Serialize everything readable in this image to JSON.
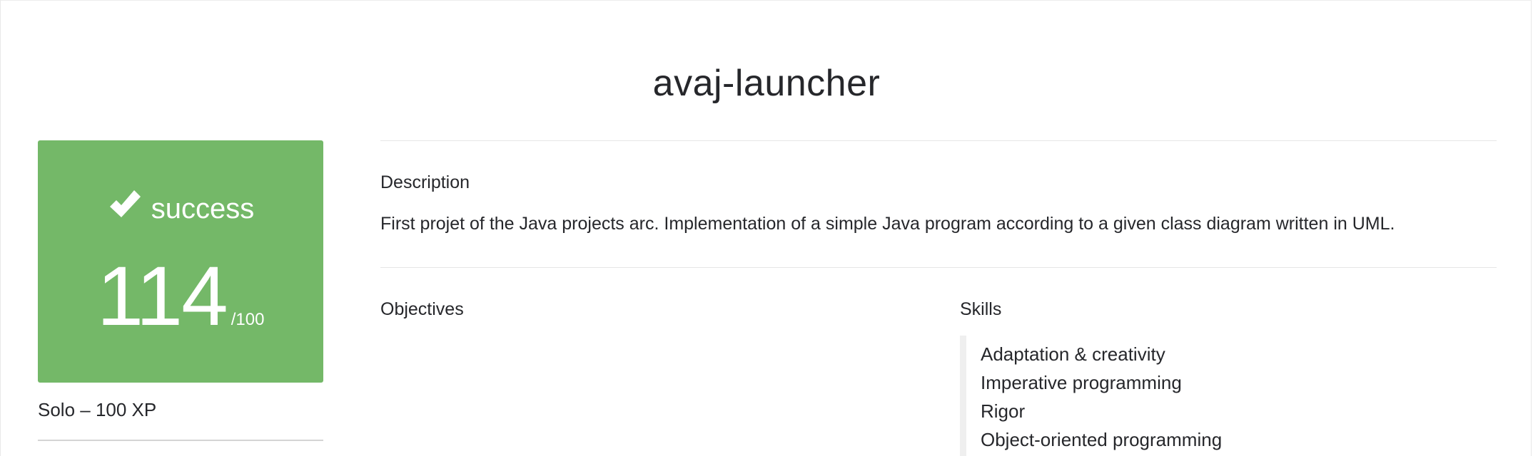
{
  "project": {
    "title": "avaj-launcher"
  },
  "result": {
    "status_icon": "check-icon",
    "status_label": "success",
    "score": "114",
    "score_max": "/100",
    "color": "#74b868"
  },
  "meta": {
    "line": "Solo – 100 XP"
  },
  "description": {
    "heading": "Description",
    "text": "First projet of the Java projects arc. Implementation of a simple Java program according to a given class diagram written in UML."
  },
  "objectives": {
    "heading": "Objectives"
  },
  "skills": {
    "heading": "Skills",
    "items": [
      "Adaptation & creativity",
      "Imperative programming",
      "Rigor",
      "Object-oriented programming"
    ]
  }
}
